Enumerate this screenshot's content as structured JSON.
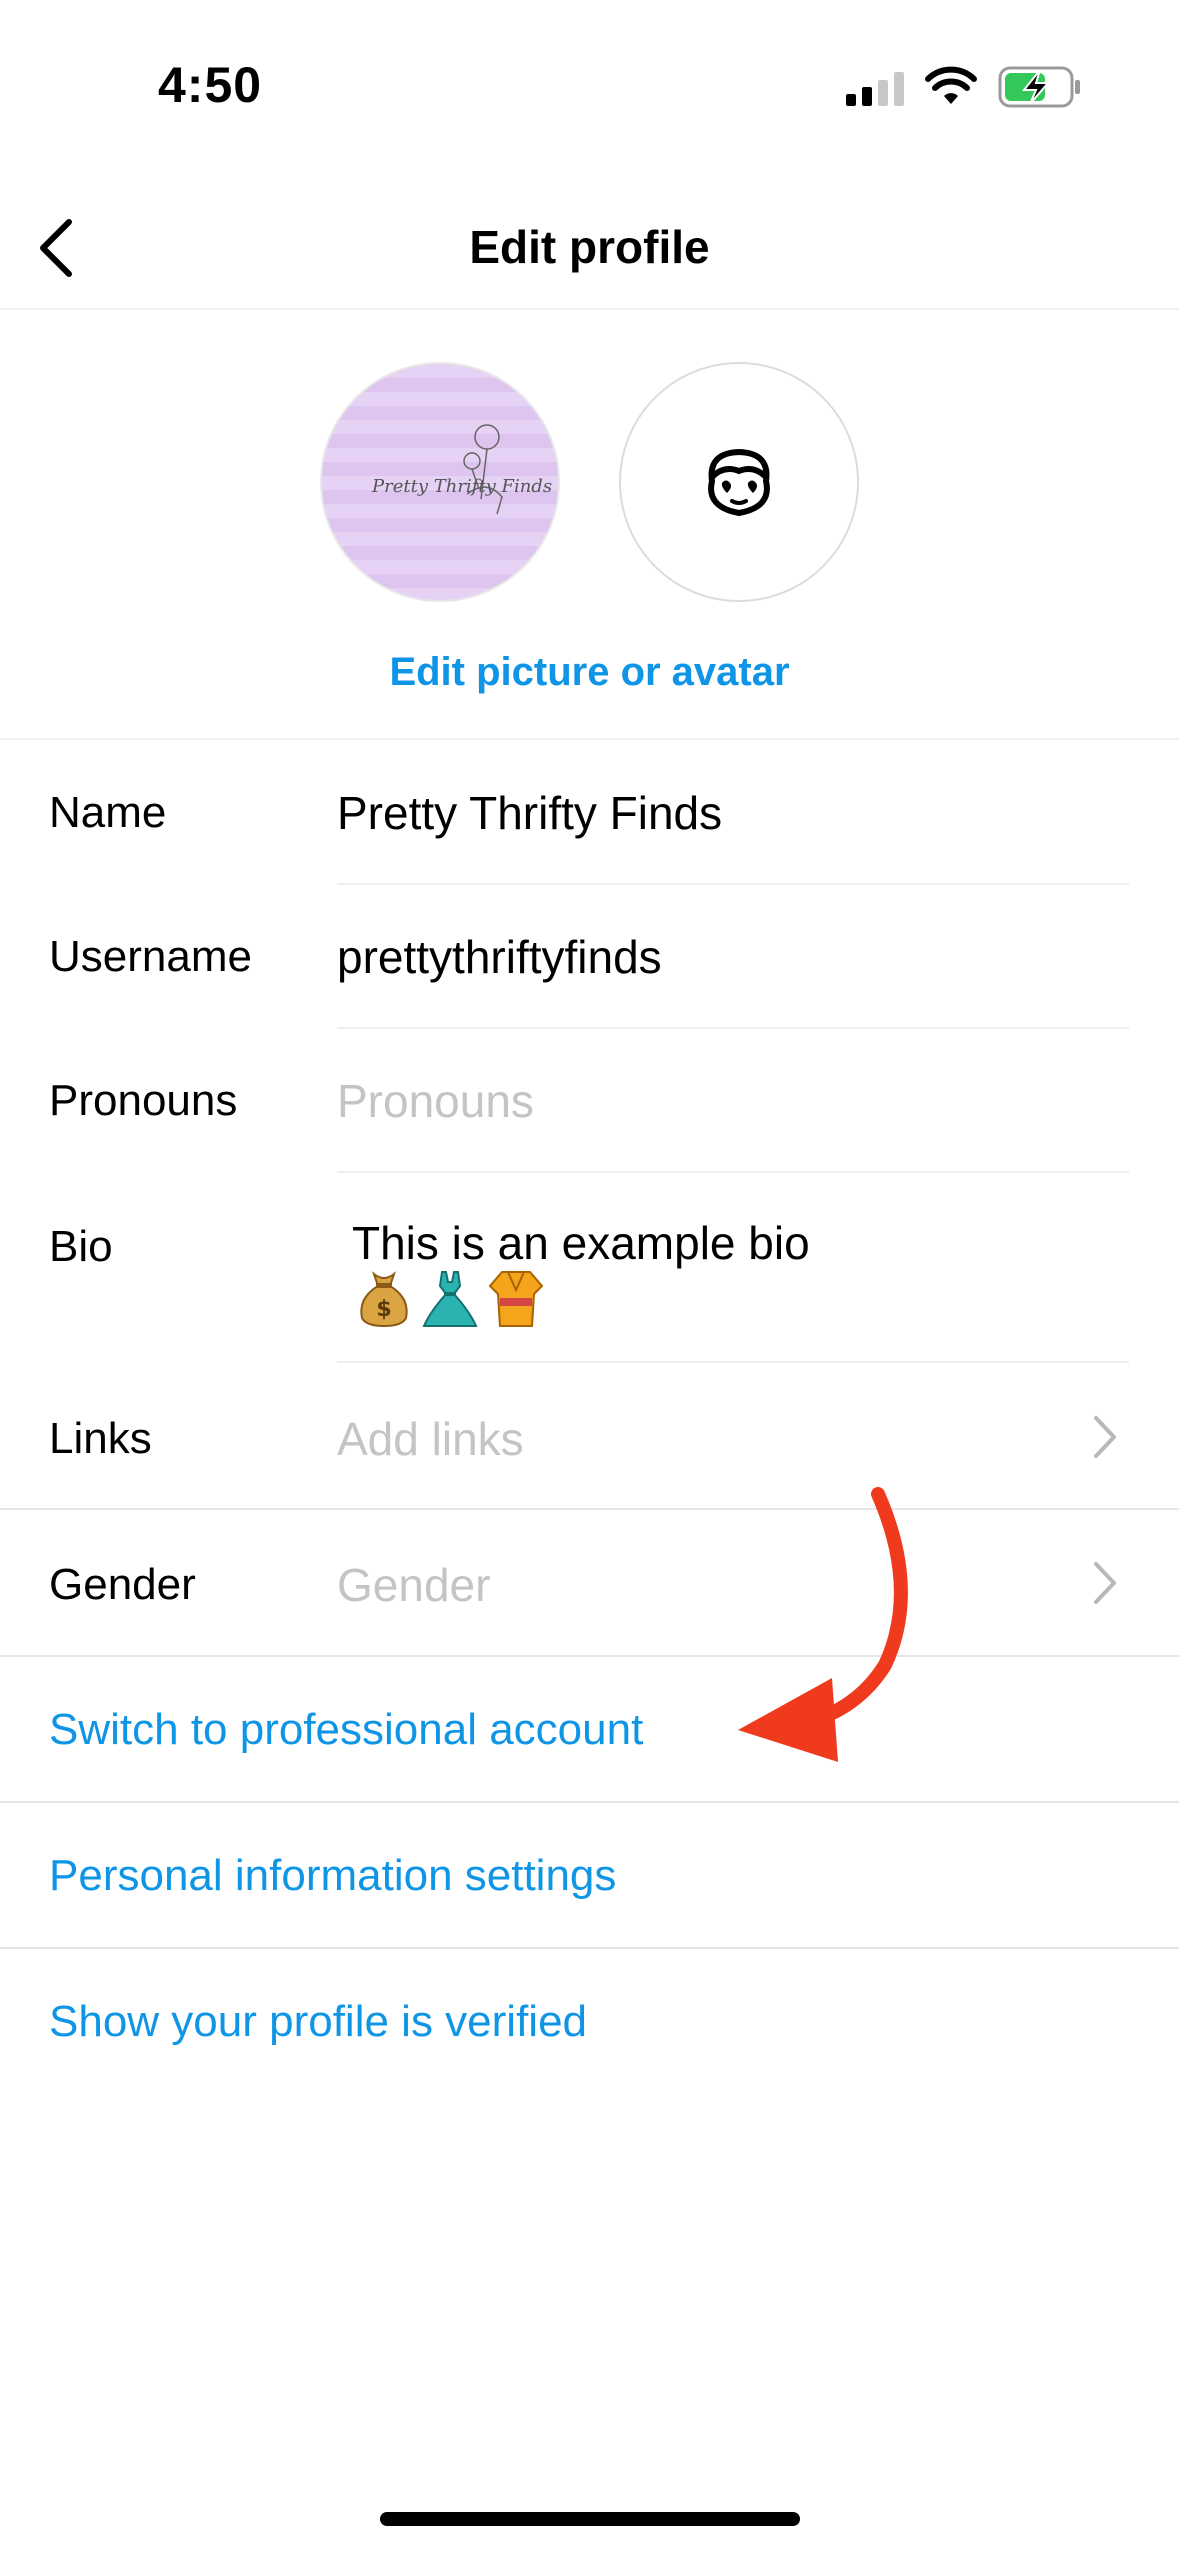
{
  "status_bar": {
    "time": "4:50",
    "icons": [
      "cellular-signal-icon",
      "wifi-icon",
      "battery-charging-icon"
    ],
    "battery_color": "#34c759"
  },
  "header": {
    "title": "Edit profile",
    "back_icon": "chevron-left-icon"
  },
  "avatars": {
    "photo_text": "Pretty Thrifty Finds",
    "avatar_icon": "avatar-character-icon",
    "edit_label": "Edit picture or avatar"
  },
  "form": {
    "name": {
      "label": "Name",
      "value": "Pretty Thrifty Finds"
    },
    "username": {
      "label": "Username",
      "value": "prettythriftyfinds"
    },
    "pronouns": {
      "label": "Pronouns",
      "placeholder": "Pronouns"
    },
    "bio": {
      "label": "Bio",
      "value": "This is an example bio",
      "emojis": [
        "💰",
        "👗",
        "👘"
      ]
    },
    "links": {
      "label": "Links",
      "placeholder": "Add links"
    },
    "gender": {
      "label": "Gender",
      "placeholder": "Gender"
    }
  },
  "actions": {
    "professional": "Switch to professional account",
    "personal_info": "Personal information settings",
    "verified": "Show your profile is verified"
  },
  "colors": {
    "link_blue": "#0f95e6",
    "annotation_red": "#f03a1e",
    "placeholder_gray": "#c4c4c4"
  }
}
